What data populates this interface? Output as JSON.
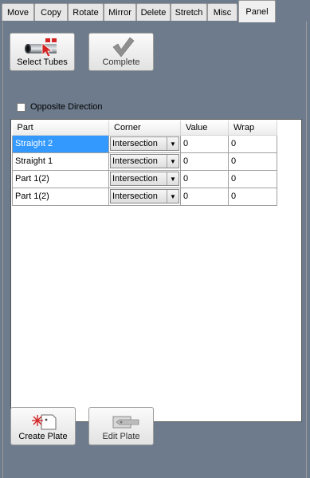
{
  "tabs": [
    "Move",
    "Copy",
    "Rotate",
    "Mirror",
    "Delete",
    "Stretch",
    "Misc",
    "Panel"
  ],
  "active_tab": "Panel",
  "toolbar": {
    "select_tubes_label": "Select Tubes",
    "complete_label": "Complete"
  },
  "options": {
    "opposite_direction_label": "Opposite Direction",
    "opposite_direction_checked": false
  },
  "grid": {
    "columns": [
      "Part",
      "Corner",
      "Value",
      "Wrap"
    ],
    "rows": [
      {
        "part": "Straight 2",
        "corner": "Intersection",
        "value": "0",
        "wrap": "0",
        "selected": true
      },
      {
        "part": "Straight 1",
        "corner": "Intersection",
        "value": "0",
        "wrap": "0",
        "selected": false
      },
      {
        "part": "Part 1(2)",
        "corner": "Intersection",
        "value": "0",
        "wrap": "0",
        "selected": false
      },
      {
        "part": "Part 1(2)",
        "corner": "Intersection",
        "value": "0",
        "wrap": "0",
        "selected": false
      }
    ]
  },
  "bottom": {
    "create_plate_label": "Create Plate",
    "edit_plate_label": "Edit Plate"
  },
  "colors": {
    "background": "#6d7b8d",
    "selection": "#3399ff",
    "accent_red": "#d42424"
  }
}
